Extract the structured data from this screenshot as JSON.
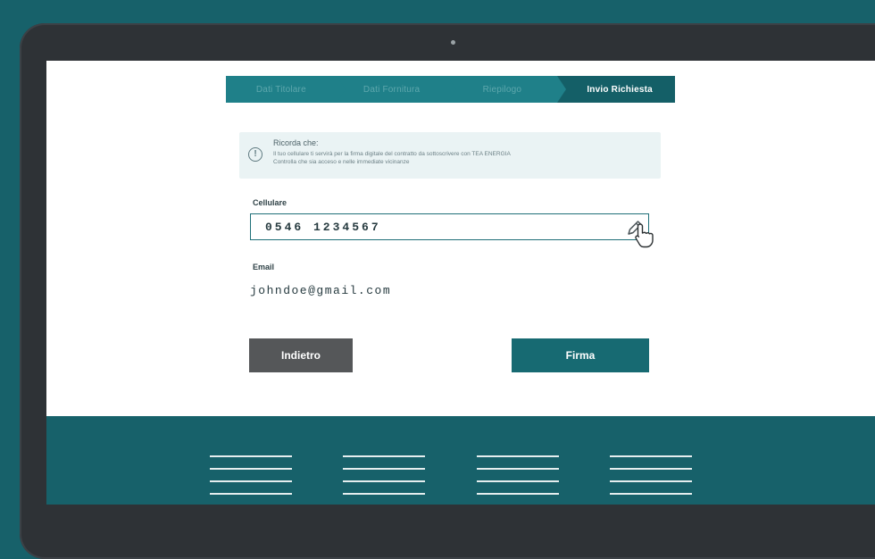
{
  "stepper": {
    "steps": [
      "Dati Titolare",
      "Dati Fornitura",
      "Riepilogo",
      "Invio Richiesta"
    ],
    "active_index": 3
  },
  "info": {
    "title": "Ricorda che:",
    "line1": "Il tuo cellulare ti servirà per la firma digitale del contratto da sottoscrivere con TEA ENERGIA",
    "line2": "Controlla che sia acceso e nelle immediate vicinanze"
  },
  "form": {
    "phone_label": "Cellulare",
    "phone_value": "0546 1234567",
    "email_label": "Email",
    "email_value": "johndoe@gmail.com"
  },
  "buttons": {
    "back_label": "Indietro",
    "sign_label": "Firma"
  },
  "colors": {
    "brand_teal": "#176a72",
    "step_teal": "#1f8089",
    "back_gray": "#555759",
    "info_bg": "#eaf3f4"
  },
  "icons": {
    "info": "info-circle-icon",
    "edit": "pencil-icon",
    "cursor": "hand-cursor-icon"
  }
}
